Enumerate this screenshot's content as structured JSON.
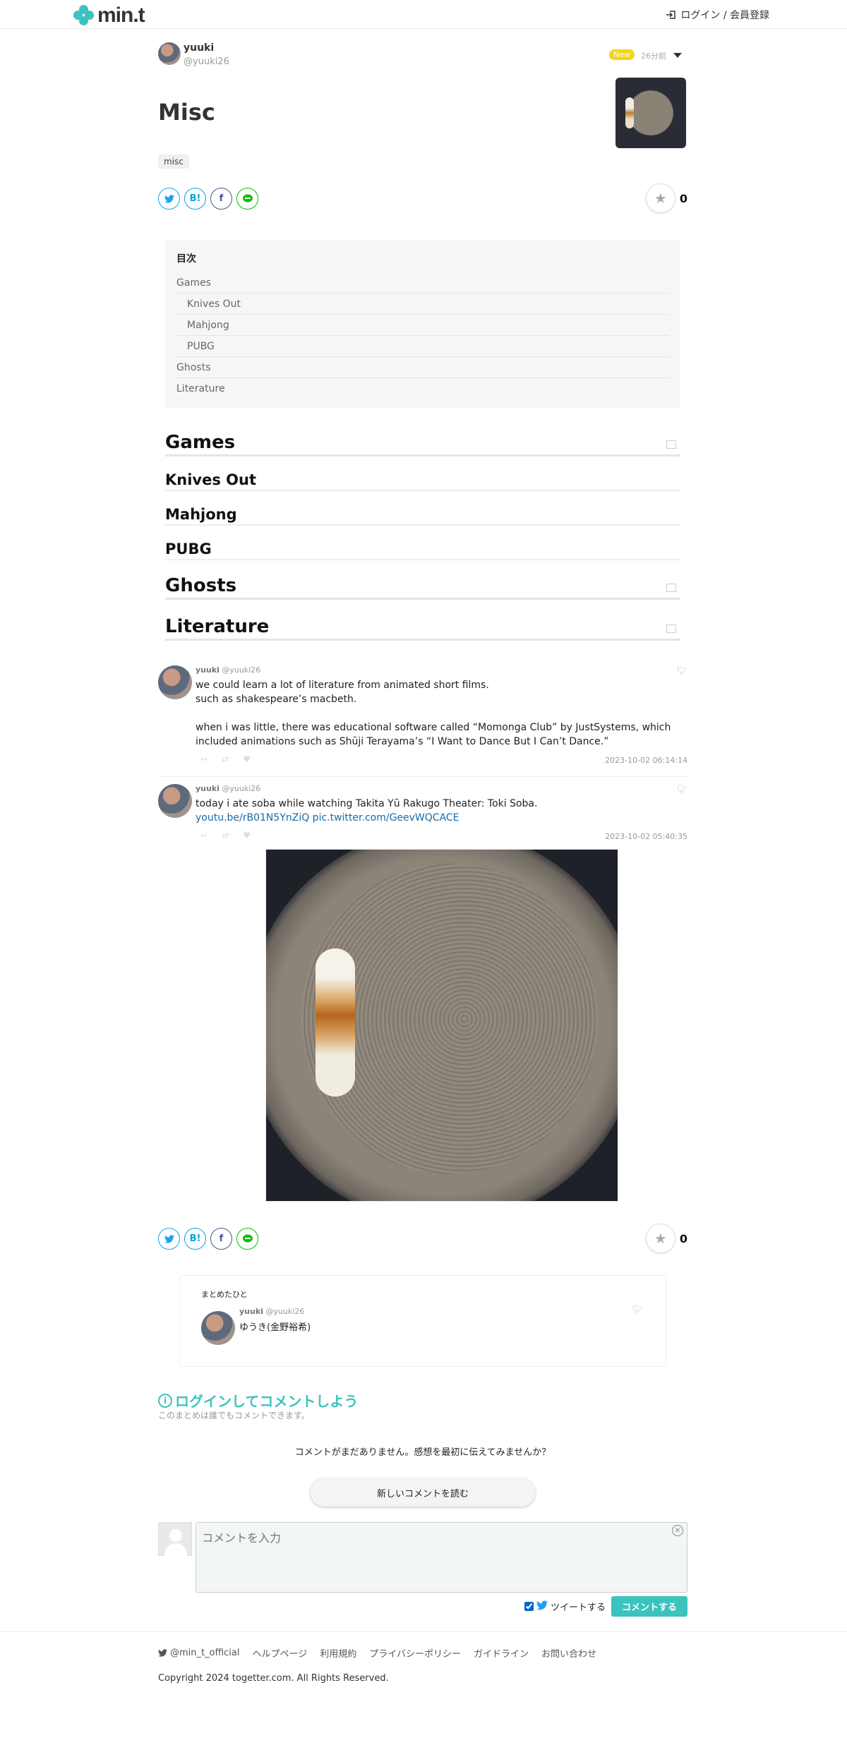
{
  "header": {
    "logo_text": "min.t",
    "login_label": "ログイン / 会員登録"
  },
  "author": {
    "name": "yuuki",
    "handle": "@yuuki26",
    "new_badge": "New",
    "time_ago": "26分前"
  },
  "article": {
    "title": "Misc",
    "tag": "misc",
    "like_count": "0"
  },
  "share": {
    "twitter": "",
    "hatena": "B!",
    "facebook": "f",
    "line": "LINE"
  },
  "toc": {
    "title": "目次",
    "items": [
      {
        "label": "Games",
        "level": 1
      },
      {
        "label": "Knives Out",
        "level": 2
      },
      {
        "label": "Mahjong",
        "level": 2
      },
      {
        "label": "PUBG",
        "level": 2
      },
      {
        "label": "Ghosts",
        "level": 1
      },
      {
        "label": "Literature",
        "level": 1
      }
    ]
  },
  "sections": {
    "games": "Games",
    "knives_out": "Knives Out",
    "mahjong": "Mahjong",
    "pubg": "PUBG",
    "ghosts": "Ghosts",
    "literature": "Literature"
  },
  "tweets": [
    {
      "name": "yuuki",
      "handle": "@yuuki26",
      "line1": "we could learn a lot of literature from animated short films.",
      "line2": "such as shakespeare’s macbeth.",
      "line3": "when i was little, there was educational software called “Momonga Club” by JustSystems, which included animations such as Shūji Terayama’s “I Want to Dance But I Can’t Dance.”",
      "date": "2023-10-02 06:14:14"
    },
    {
      "name": "yuuki",
      "handle": "@yuuki26",
      "line1": "today i ate soba while watching Takita Yū Rakugo Theater: Toki Soba.",
      "link": "youtu.be/rB01N5YnZiQ pic.twitter.com/GeevWQCACE",
      "date": "2023-10-02 05:40:35"
    }
  ],
  "curator": {
    "label": "まとめたひと",
    "name": "yuuki",
    "handle": "@yuuki26",
    "description": "ゆうき(金野裕希)"
  },
  "comments": {
    "title": "ログインしてコメントしよう",
    "subtitle": "このまとめは誰でもコメントできます。",
    "empty_text": "コメントがまだありません。感想を最初に伝えてみませんか？",
    "read_button": "新しいコメントを読む",
    "input_placeholder": "コメントを入力",
    "tweet_label": "ツイートする",
    "submit_label": "コメントする"
  },
  "footer": {
    "twitter": "@min_t_official",
    "links": [
      "ヘルプページ",
      "利用規約",
      "プライバシーポリシー",
      "ガイドライン",
      "お問い合わせ"
    ],
    "copyright": "Copyright 2024 togetter.com. All Rights Reserved."
  },
  "colors": {
    "accent": "#3cc3bd",
    "new_badge": "#f7d11b",
    "link": "#1b6aa5"
  }
}
